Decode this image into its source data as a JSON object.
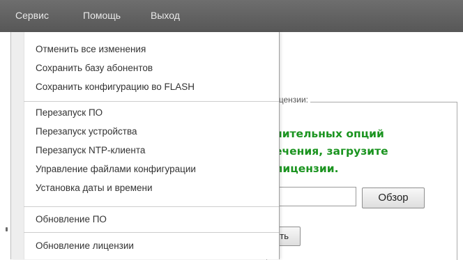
{
  "menubar": {
    "items": [
      "Сервис",
      "Помощь",
      "Выход"
    ]
  },
  "dropdown": {
    "items": [
      "Отменить все изменения",
      "Сохранить базу абонентов",
      "Сохранить конфигурацию во FLASH",
      "Перезапуск ПО",
      "Перезапуск устройства",
      "Перезапуск NTP-клиента",
      "Управление файлами конфигурации",
      "Установка даты и времени",
      "Обновление ПО",
      "Обновление лицензии"
    ]
  },
  "license_panel": {
    "legend": "ицензии:",
    "message": "нительных опций\nечения, загрузите\nлицензии.",
    "browse_label": "Обзор",
    "upload_label": "ить"
  },
  "colors": {
    "menubar": "#5f5f5f",
    "message_green": "#1b9420"
  }
}
